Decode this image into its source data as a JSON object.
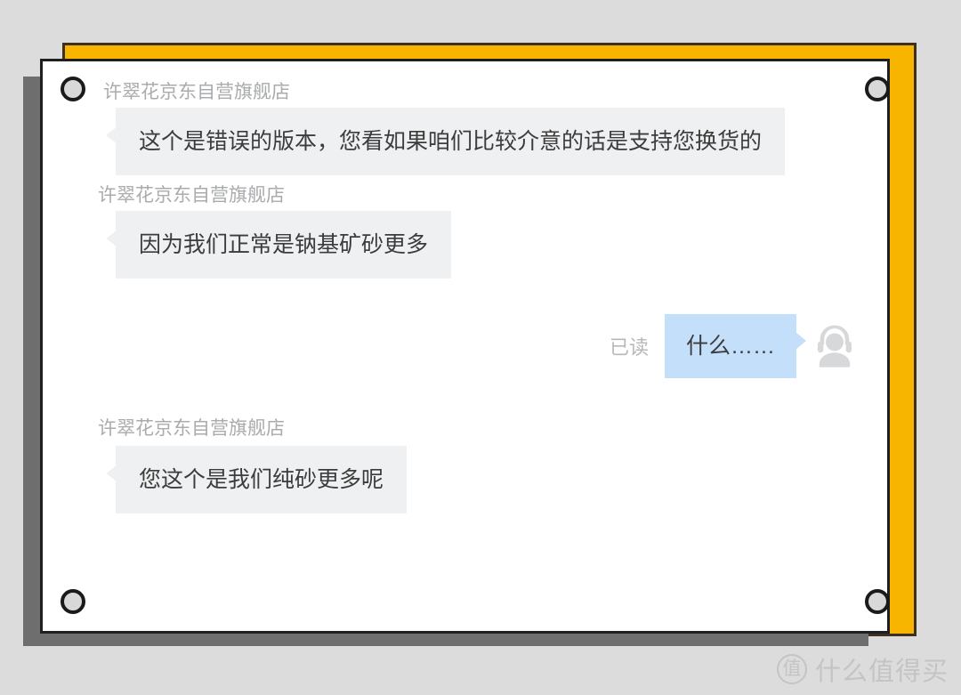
{
  "theme": {
    "page_background": "#dcdcdc",
    "accent_panel": "#f7b500",
    "accent_border": "#3d3021",
    "shadow_panel": "#6e6e6e",
    "card_background": "#ffffff",
    "card_border": "#1f1f1f",
    "incoming_bubble": "#eff0f1",
    "outgoing_bubble": "#c3dffa",
    "sender_name_color": "#a9abad",
    "message_text_color": "#3c3c3c",
    "rivet_fill": "#d8d8d8",
    "watermark_color": "#c4c4c4"
  },
  "chat": {
    "messages": [
      {
        "id": "msg-1",
        "direction": "incoming",
        "sender": "许翠花京东自营旗舰店",
        "text": "这个是错误的版本，您看如果咱们比较介意的话是支持您换货的"
      },
      {
        "id": "msg-2",
        "direction": "incoming",
        "sender": "许翠花京东自营旗舰店",
        "text": "因为我们正常是钠基矿砂更多"
      },
      {
        "id": "msg-3",
        "direction": "outgoing",
        "sender": "",
        "text": "什么……",
        "status": "已读",
        "avatar_icon": "headset-agent-icon"
      },
      {
        "id": "msg-4",
        "direction": "incoming",
        "sender": "许翠花京东自营旗舰店",
        "text": "您这个是我们纯砂更多呢"
      }
    ]
  },
  "frame": {
    "rivets": [
      {
        "name": "rivet-top-left"
      },
      {
        "name": "rivet-top-right"
      },
      {
        "name": "rivet-bottom-left"
      },
      {
        "name": "rivet-bottom-right"
      }
    ]
  },
  "watermark": {
    "badge": "值",
    "text": "什么值得买"
  }
}
